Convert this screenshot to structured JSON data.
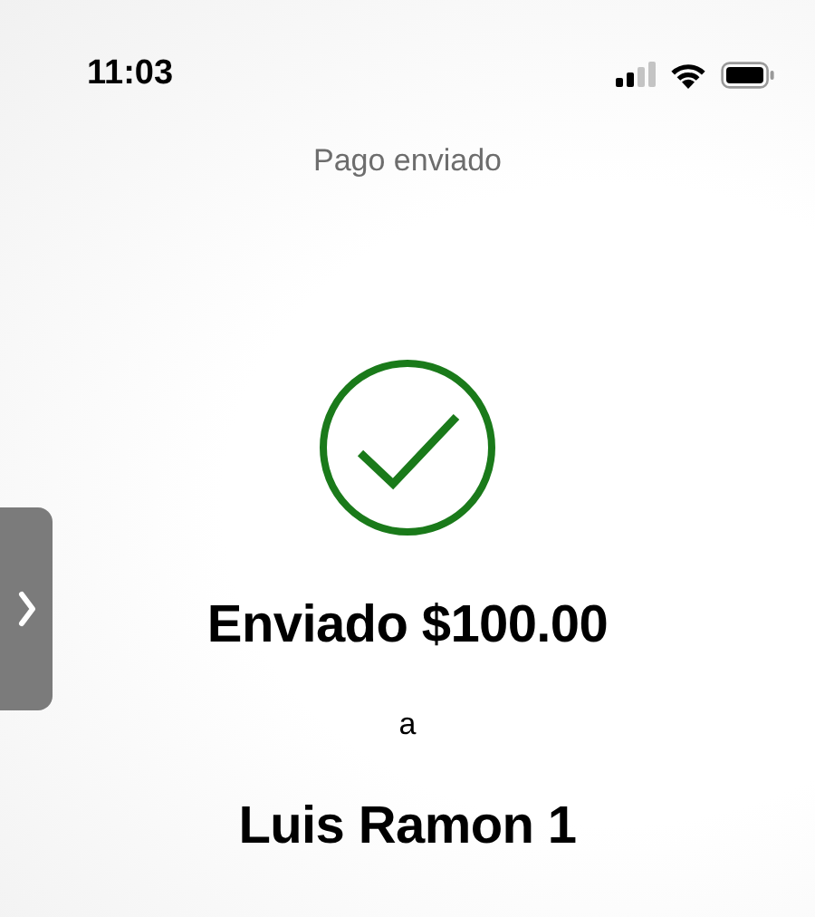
{
  "status_bar": {
    "time": "11:03"
  },
  "header": {
    "title": "Pago enviado"
  },
  "confirmation": {
    "headline": "Enviado $100.00",
    "connector": "a",
    "recipient": "Luis Ramon 1"
  }
}
